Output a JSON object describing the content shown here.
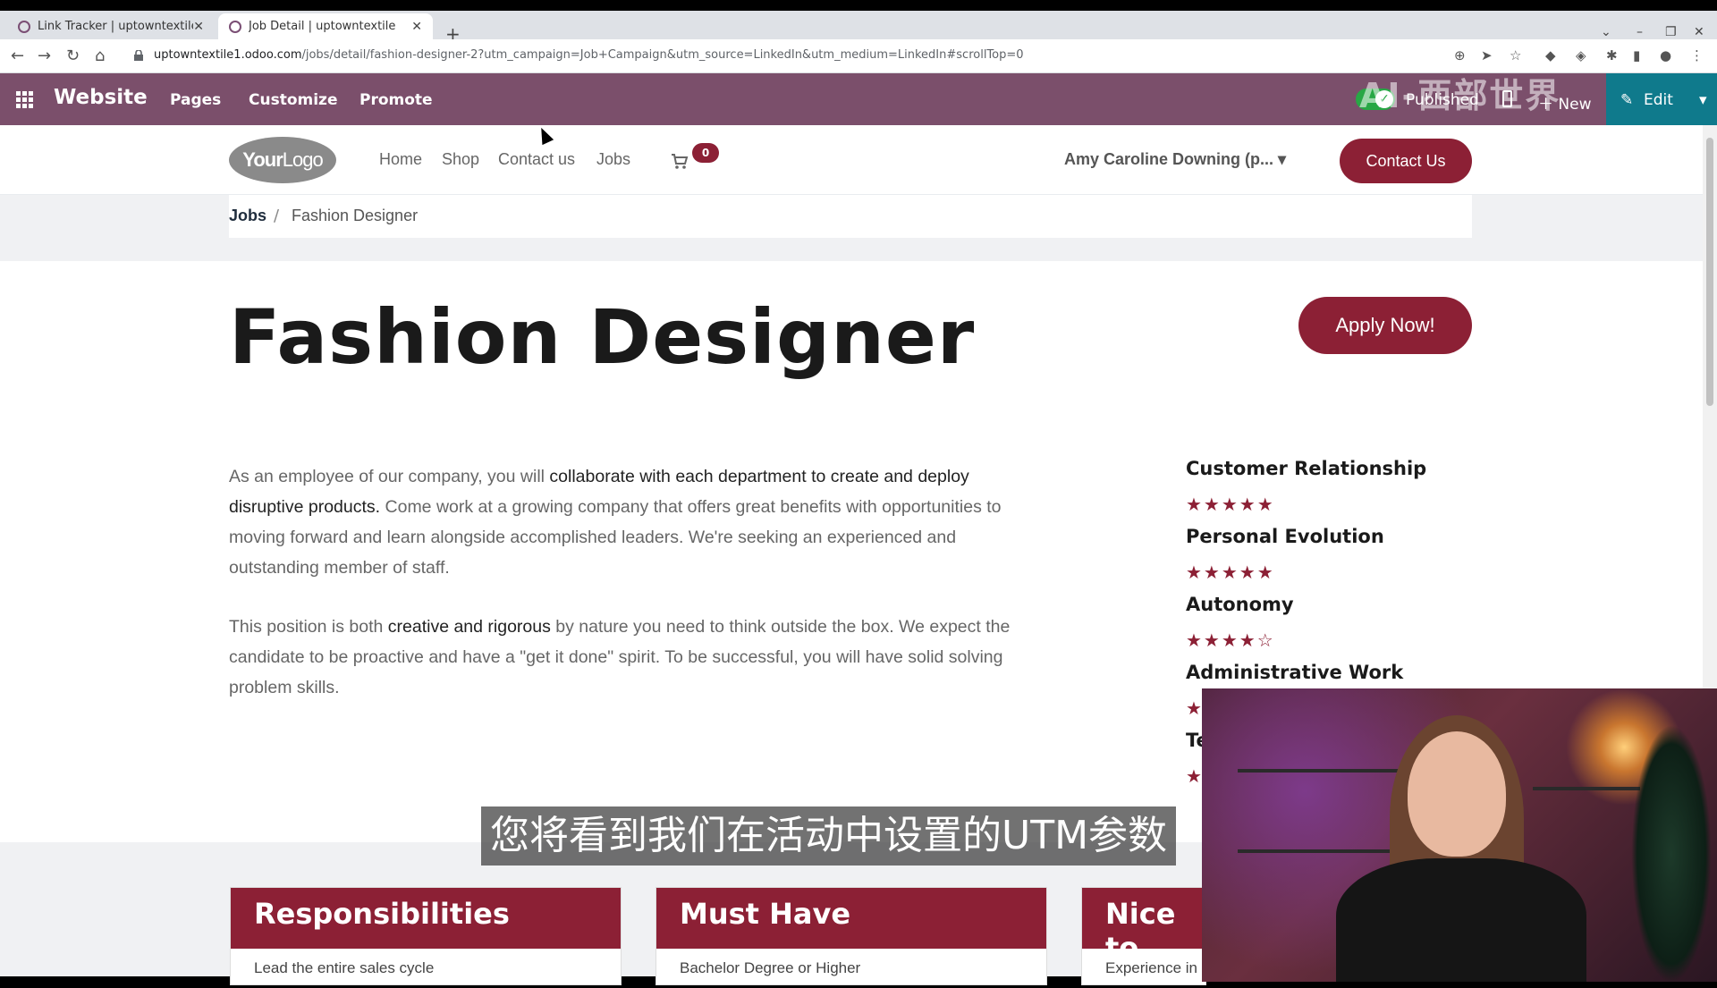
{
  "browser": {
    "tabs": [
      {
        "label": "Link Tracker | uptowntextile"
      },
      {
        "label": "Job Detail | uptowntextile"
      }
    ],
    "url_host": "uptowntextile1.odoo.com",
    "url_path": "/jobs/detail/fashion-designer-2?utm_campaign=Job+Campaign&utm_source=LinkedIn&utm_medium=LinkedIn#scrollTop=0"
  },
  "odoo_bar": {
    "brand": "Website",
    "menu": [
      "Pages",
      "Customize",
      "Promote"
    ],
    "published": "Published",
    "new": "New",
    "edit": "Edit"
  },
  "watermark": "AI-西部世界",
  "site_header": {
    "logo_bold": "Your",
    "logo_rest": "Logo",
    "nav": [
      "Home",
      "Shop",
      "Contact us",
      "Jobs"
    ],
    "cart_count": "0",
    "user": "Amy Caroline Downing (p...",
    "contact_button": "Contact Us"
  },
  "breadcrumb": {
    "parent": "Jobs",
    "separator": "/",
    "current": "Fashion Designer"
  },
  "job": {
    "title": "Fashion Designer",
    "apply_button": "Apply Now!",
    "para1": {
      "a": "As an employee of our company, you will ",
      "b": "collaborate with each department to create and deploy disruptive products.",
      "c": " Come work at a growing company that offers great benefits with opportunities to moving forward and learn alongside accomplished leaders. We're seeking an experienced and outstanding member of staff."
    },
    "para2": {
      "a": "This position is both ",
      "b": "creative and rigorous",
      "c": " by nature you need to think outside the box. We expect the candidate to be proactive and have a \"get it done\" spirit. To be successful, you will have solid solving problem skills."
    },
    "skills": [
      {
        "name": "Customer Relationship",
        "rating": 5,
        "stars": "★★★★★"
      },
      {
        "name": "Personal Evolution",
        "rating": 5,
        "stars": "★★★★★"
      },
      {
        "name": "Autonomy",
        "rating": 4,
        "stars": "★★★★☆"
      },
      {
        "name": "Administrative Work",
        "rating": 1,
        "stars": "★"
      },
      {
        "name": "Te",
        "rating": 1,
        "stars": "★"
      }
    ]
  },
  "cards": [
    {
      "title": "Responsibilities",
      "text": "Lead the entire sales cycle"
    },
    {
      "title": "Must Have",
      "text": "Bachelor Degree or Higher"
    },
    {
      "title": "Nice to",
      "text": "Experience in"
    }
  ],
  "subtitle": "您将看到我们在活动中设置的UTM参数",
  "colors": {
    "brand": "#8c2035",
    "odoo_bar": "#7b4f6b",
    "edit": "#0f7a8c"
  }
}
